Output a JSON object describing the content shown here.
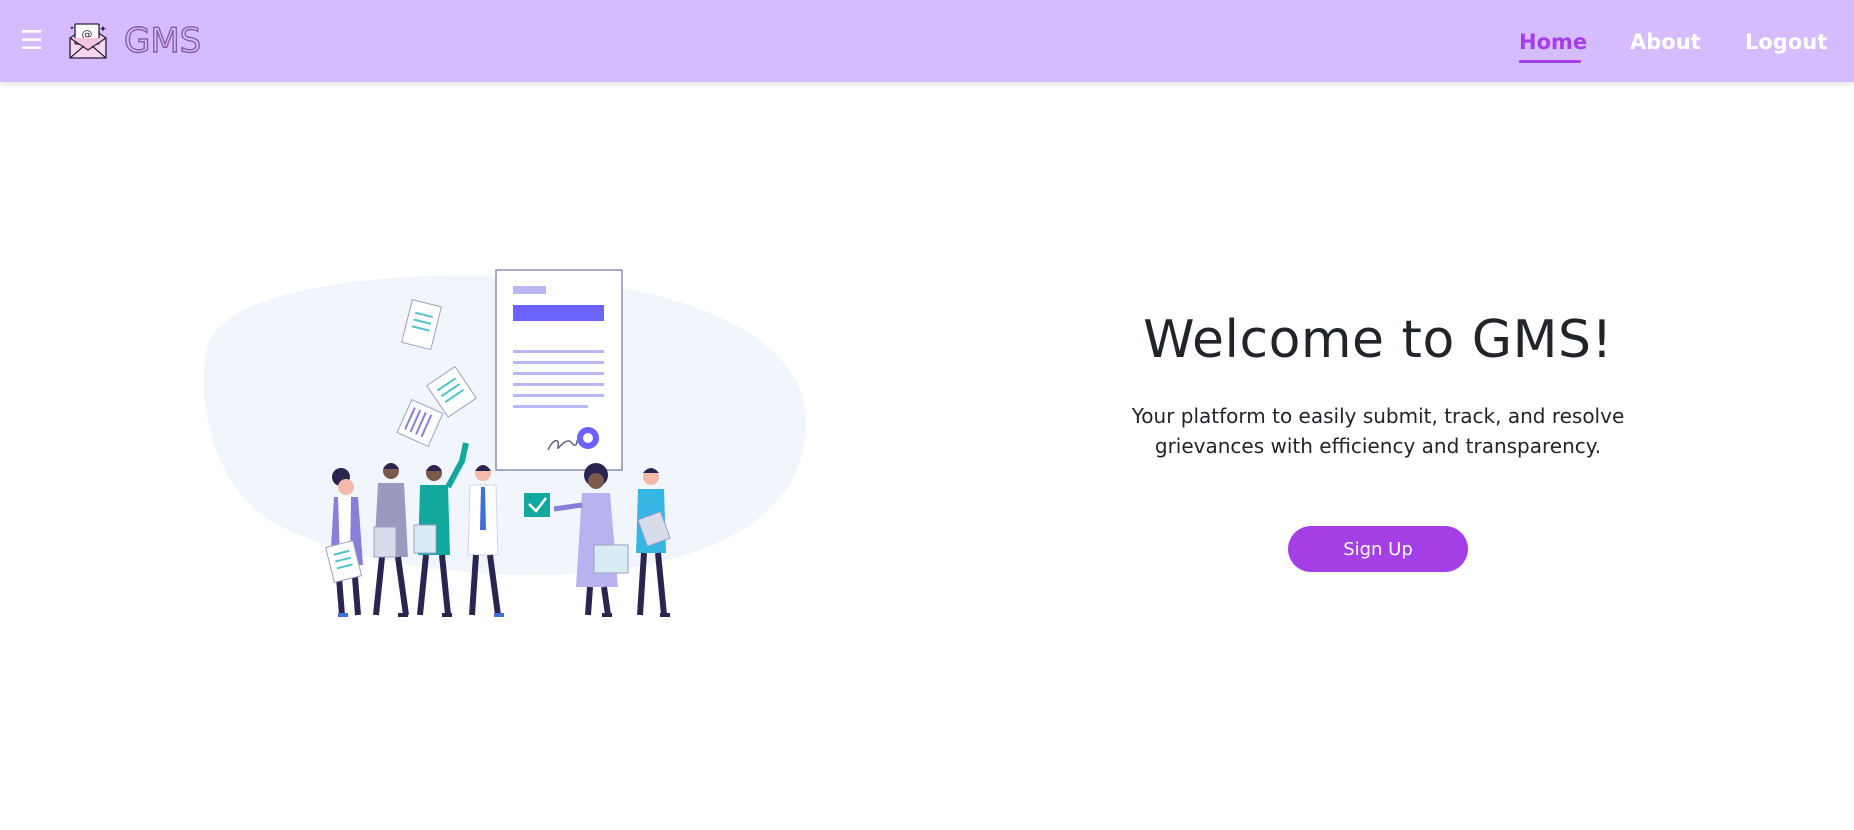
{
  "navbar": {
    "menu_icon": "hamburger-icon",
    "logo_icon": "mail-envelope-icon",
    "logo_text": "GMS",
    "links": [
      "Home",
      "About",
      "Logout"
    ],
    "active_link": "Home"
  },
  "hero": {
    "title": "Welcome to GMS!",
    "subtitle": "Your platform to easily submit, track, and resolve grievances with efficiency and transparency.",
    "signup_label": "Sign Up"
  },
  "colors": {
    "navbar_bg": "#d4bcff",
    "accent": "#a43fe6",
    "text": "#212529"
  }
}
